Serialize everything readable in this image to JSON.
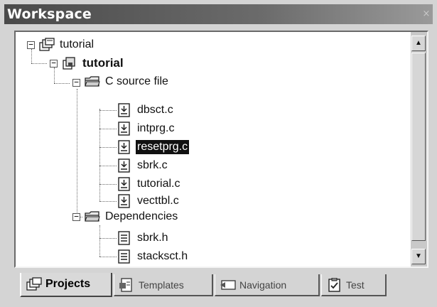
{
  "window": {
    "title": "Workspace",
    "close_glyph": "×"
  },
  "tree": {
    "nodes": [
      {
        "label": "tutorial",
        "icon": "workspace-icon",
        "expanded": true,
        "bold": false,
        "selected": false
      },
      {
        "label": "tutorial",
        "icon": "project-icon",
        "expanded": true,
        "bold": true,
        "selected": false
      },
      {
        "label": "C source file",
        "icon": "folder-open-icon",
        "expanded": true,
        "bold": false,
        "selected": false
      },
      {
        "label": "dbsct.c",
        "icon": "c-file-icon",
        "bold": false,
        "selected": false
      },
      {
        "label": "intprg.c",
        "icon": "c-file-icon",
        "bold": false,
        "selected": false
      },
      {
        "label": "resetprg.c",
        "icon": "c-file-icon",
        "bold": false,
        "selected": true
      },
      {
        "label": "sbrk.c",
        "icon": "c-file-icon",
        "bold": false,
        "selected": false
      },
      {
        "label": "tutorial.c",
        "icon": "c-file-icon",
        "bold": false,
        "selected": false
      },
      {
        "label": "vecttbl.c",
        "icon": "c-file-icon",
        "bold": false,
        "selected": false
      },
      {
        "label": "Dependencies",
        "icon": "folder-open-icon",
        "expanded": true,
        "bold": false,
        "selected": false
      },
      {
        "label": "sbrk.h",
        "icon": "header-file-icon",
        "bold": false,
        "selected": false
      },
      {
        "label": "stacksct.h",
        "icon": "header-file-icon",
        "bold": false,
        "selected": false
      }
    ],
    "expander_glyph": "−"
  },
  "scrollbar": {
    "up_glyph": "▲",
    "down_glyph": "▼"
  },
  "tabs": [
    {
      "label": "Projects",
      "icon": "projects-tab-icon",
      "active": true
    },
    {
      "label": "Templates",
      "icon": "templates-tab-icon",
      "active": false
    },
    {
      "label": "Navigation",
      "icon": "navigation-tab-icon",
      "active": false
    },
    {
      "label": "Test",
      "icon": "test-tab-icon",
      "active": false
    }
  ]
}
